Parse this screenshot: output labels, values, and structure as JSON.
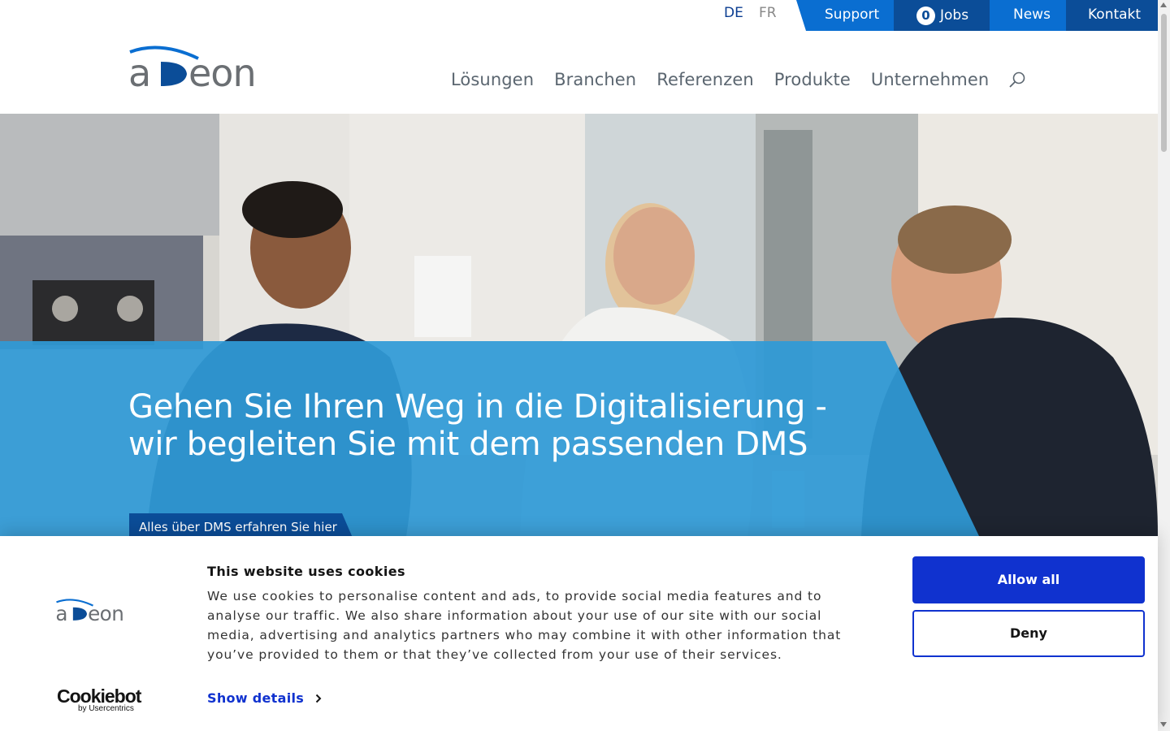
{
  "language": {
    "de": "DE",
    "fr": "FR"
  },
  "topbar": {
    "support": "Support",
    "jobs_count": "0",
    "jobs": "Jobs",
    "news": "News",
    "kontakt": "Kontakt"
  },
  "nav": {
    "items": [
      "Lösungen",
      "Branchen",
      "Referenzen",
      "Produkte",
      "Unternehmen"
    ]
  },
  "hero": {
    "title_line1": "Gehen Sie Ihren Weg in die Digitalisierung -",
    "title_line2": "wir begleiten Sie mit dem passenden DMS",
    "cta": "Alles über DMS erfahren Sie hier"
  },
  "cookie": {
    "title": "This website uses cookies",
    "text": "We use cookies to personalise content and ads, to provide social media features and to analyse our traffic. We also share information about your use of our site with our social media, advertising and analytics partners who may combine it with other information that you’ve provided to them or that they’ve collected from your use of their services.",
    "show_details": "Show details",
    "allow_all": "Allow all",
    "deny": "Deny",
    "brand": "Cookiebot",
    "brand_by": "by Usercentrics"
  },
  "logo": {
    "text": "adeon"
  },
  "colors": {
    "brand_dark_blue": "#0b4d98",
    "brand_blue": "#0a6ed1",
    "hero_overlay": "#2f9ad6",
    "cookie_button": "#1032cf",
    "nav_text": "#5b6670"
  }
}
